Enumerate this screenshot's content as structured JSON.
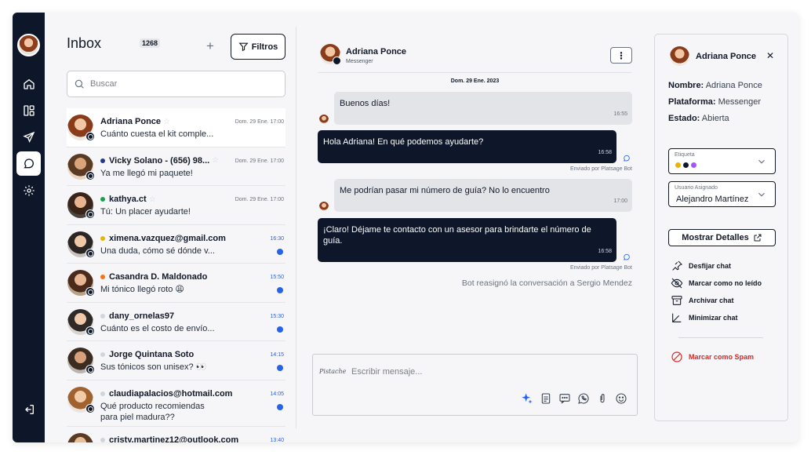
{
  "colors": {
    "navy": "#0e1629",
    "accent_blue": "#2563eb",
    "spam_red": "#dc2626"
  },
  "nav": {
    "items": [
      {
        "icon": "home-icon"
      },
      {
        "icon": "layout-icon"
      },
      {
        "icon": "send-icon"
      },
      {
        "icon": "chat-icon",
        "active": true
      },
      {
        "icon": "gear-icon"
      },
      {
        "icon": "logout-icon"
      }
    ]
  },
  "inbox": {
    "title": "Inbox",
    "count": "1268",
    "filter_label": "Filtros",
    "search_placeholder": "Buscar",
    "chats": [
      {
        "name": "Adriana Ponce",
        "message": "Cuánto cuesta el kit comple...",
        "time": "Dom. 29 Ene. 17:00",
        "status": "",
        "starred": true,
        "unread": false,
        "channel": "messenger"
      },
      {
        "name": "Vicky Solano - (656) 98...",
        "message": "Ya me llegó mi paquete!",
        "time": "Dom. 29 Ene. 17:00",
        "status": "#1e3a8a",
        "starred": true,
        "unread": false,
        "channel": "whatsapp"
      },
      {
        "name": "kathya.ct",
        "message": "Tú: Un placer ayudarte!",
        "time": "Dom. 29 Ene. 17:00",
        "status": "#16a34a",
        "starred": true,
        "unread": false,
        "channel": "instagram"
      },
      {
        "name": "ximena.vazquez@gmail.com",
        "message": "Una duda, cómo sé dónde v...",
        "time": "16:30",
        "status": "#eab308",
        "starred": false,
        "unread": true,
        "channel": "email"
      },
      {
        "name": "Casandra D. Maldonado",
        "message": "Mi tónico llegó roto 😩",
        "time": "15:50",
        "status": "#f97316",
        "starred": false,
        "unread": true,
        "channel": "messenger"
      },
      {
        "name": "dany_ornelas97",
        "message": "Cuánto es el costo de envío...",
        "time": "15:30",
        "status": "#d1d5db",
        "starred": false,
        "unread": true,
        "channel": "instagram"
      },
      {
        "name": "Jorge Quintana Soto",
        "message": "Sus tónicos son unisex? 👀",
        "time": "14:15",
        "status": "#d1d5db",
        "starred": false,
        "unread": true,
        "channel": "messenger"
      },
      {
        "name": "claudiapalacios@hotmail.com",
        "message": "Qué producto recomiendas para piel madura??",
        "time": "14:05",
        "status": "#d1d5db",
        "starred": false,
        "unread": true,
        "channel": "email"
      },
      {
        "name": "cristy.martinez12@outlook.com",
        "message": "",
        "time": "13:40",
        "status": "#d1d5db",
        "starred": false,
        "unread": false,
        "channel": "email"
      }
    ]
  },
  "conversation": {
    "name": "Adriana Ponce",
    "platform": "Messenger",
    "date": "Dom. 29 Ene. 2023",
    "messages": [
      {
        "dir": "in",
        "text": "Buenos días!",
        "time": "16:55"
      },
      {
        "dir": "out",
        "text": "Hola Adriana! En qué podemos ayudarte?",
        "time": "16:58",
        "sent_by": "Enviado por Platsage Bot"
      },
      {
        "dir": "in",
        "text": "Me podrían pasar mi número de guía? No lo encuentro",
        "time": "17:00"
      },
      {
        "dir": "out",
        "text": "¡Claro! Déjame te contacto con un asesor para brindarte el número de guía.",
        "time": "16:58",
        "sent_by": "Enviado por Platsage Bot"
      }
    ],
    "reassign_note": "Bot reasignó la conversación a Sergio Mendez",
    "composer": {
      "brand": "Pistache",
      "placeholder": "Escribir mensaje..."
    }
  },
  "details": {
    "name": "Adriana Ponce",
    "fields": [
      {
        "label": "Nombre:",
        "value": "Adriana Ponce"
      },
      {
        "label": "Plataforma:",
        "value": "Messenger"
      },
      {
        "label": "Estado:",
        "value": "Abierta"
      }
    ],
    "tag_label": "Etiqueta",
    "tag_colors": [
      "#eab308",
      "#111827",
      "#a855f7"
    ],
    "assignee_label": "Usuario Asignado",
    "assignee_value": "Alejandro Martínez",
    "show_details": "Mostrar Detalles",
    "actions": [
      {
        "label": "Desfijar chat",
        "icon": "unpin-icon"
      },
      {
        "label": "Marcar como no leído",
        "icon": "eye-off-icon"
      },
      {
        "label": "Archivar chat",
        "icon": "archive-icon"
      },
      {
        "label": "Minimizar chat",
        "icon": "minimize-icon"
      }
    ],
    "spam": "Marcar como Spam"
  }
}
